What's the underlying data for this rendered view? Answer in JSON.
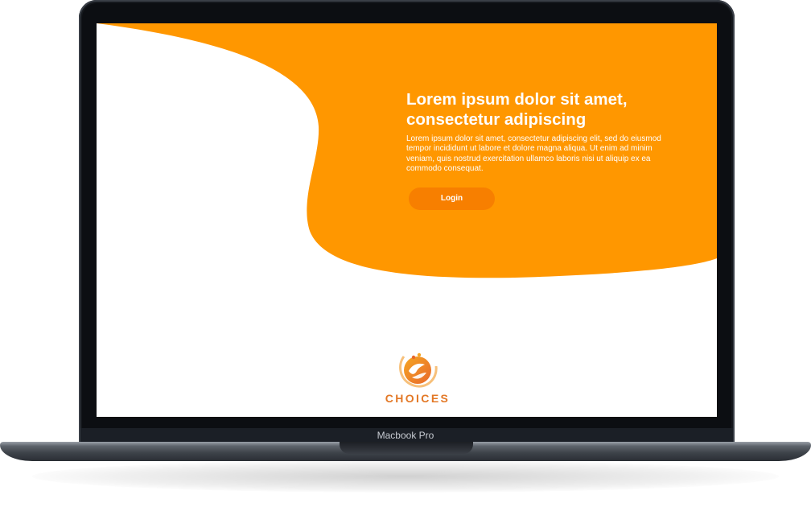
{
  "device": {
    "label": "Macbook Pro"
  },
  "hero": {
    "title": "Lorem ipsum dolor sit amet, consectetur adipiscing",
    "body": "Lorem ipsum dolor sit amet, consectetur adipiscing elit, sed do eiusmod tempor incididunt ut labore et dolore magna aliqua. Ut enim ad minim veniam, quis nostrud exercitation ullamco laboris nisi ut aliquip ex ea commodo consequat.",
    "login_label": "Login"
  },
  "brand": {
    "name": "CHOICES",
    "icon": "hands-circle-logo"
  },
  "colors": {
    "hero_background": "#ff9700",
    "button": "#f77f00",
    "brand_text": "#e37826"
  }
}
